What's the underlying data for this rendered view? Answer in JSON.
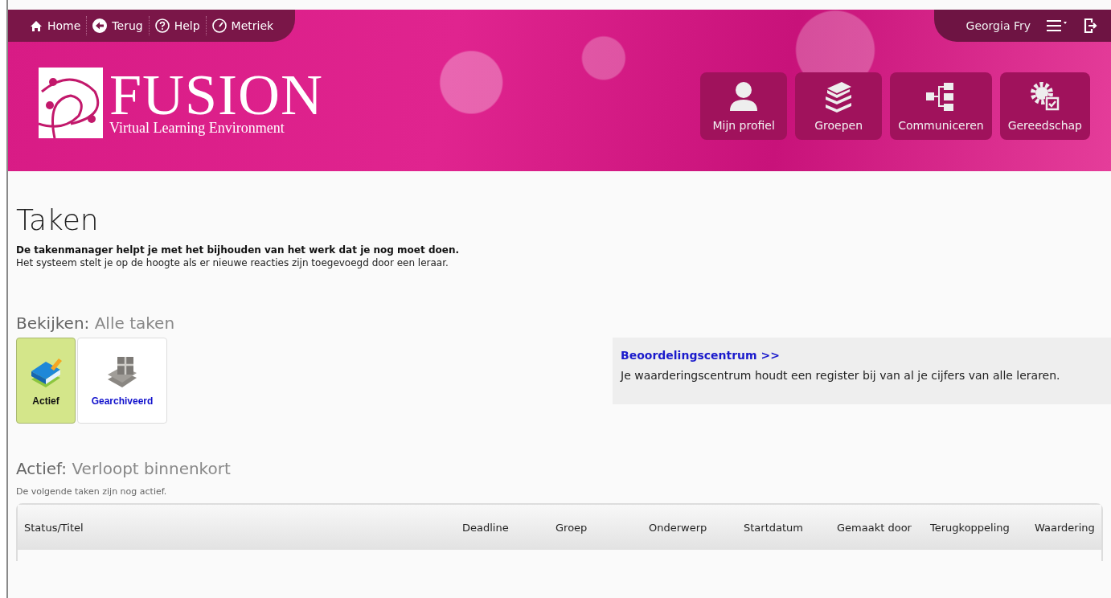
{
  "topbar": {
    "nav": [
      {
        "kind": "home",
        "label": "Home"
      },
      {
        "kind": "back",
        "label": "Terug"
      },
      {
        "kind": "help",
        "label": "Help"
      },
      {
        "kind": "gauge",
        "label": "Metriek"
      }
    ],
    "user": "Georgia Fry"
  },
  "logo": {
    "title": "FUSION",
    "subtitle": "Virtual Learning Environment"
  },
  "header_buttons": [
    {
      "kind": "person",
      "label": "Mijn profiel"
    },
    {
      "kind": "books",
      "label": "Groepen"
    },
    {
      "kind": "tree",
      "label": "Communiceren"
    },
    {
      "kind": "tools",
      "label": "Gereedschap"
    }
  ],
  "page": {
    "title": "Taken",
    "intro_bold": "De takenmanager helpt je met het bijhouden van het werk dat je nog moet doen.",
    "intro": "Het systeem stelt je op de hoogte als er nieuwe reacties zijn toegevoegd door een leraar."
  },
  "view": {
    "label": "Bekijken:",
    "value": "Alle taken",
    "tiles": [
      {
        "kind": "active",
        "label": "Actief",
        "selected": true
      },
      {
        "kind": "archived",
        "label": "Gearchiveerd",
        "selected": false
      }
    ]
  },
  "grades": {
    "link": "Beoordelingscentrum >>",
    "text": "Je waarderingscentrum houdt een register bij van al je cijfers van alle leraren."
  },
  "list": {
    "label": "Actief:",
    "value": "Verloopt binnenkort",
    "note": "De volgende taken zijn nog actief.",
    "columns": [
      "Status/Titel",
      "Deadline",
      "Groep",
      "Onderwerp",
      "Startdatum",
      "Gemaakt door",
      "Terugkoppeling",
      "Waardering"
    ]
  }
}
